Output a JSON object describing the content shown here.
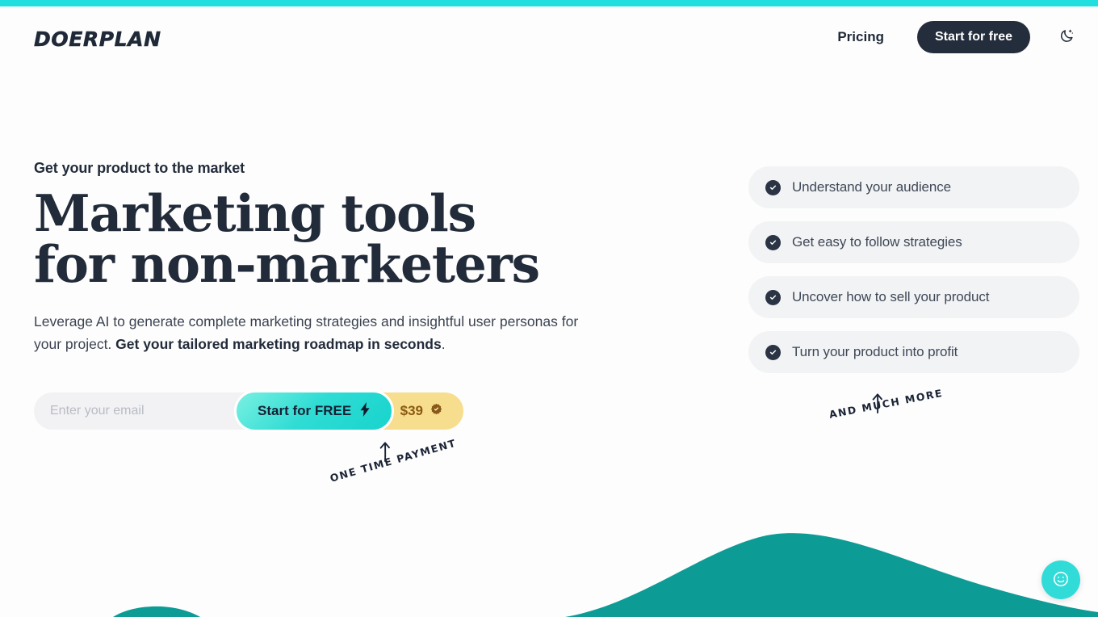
{
  "theme": {
    "accent_cyan": "#22dfdf",
    "dark_navy": "#242d3c",
    "teal_wave": "#0d9b96",
    "badge_yellow": "#f7de8e",
    "badge_text_brown": "#8a5a14",
    "pill_gray": "#f2f3f5",
    "page_background": "#fdfdfd"
  },
  "header": {
    "logo": "DOERPLAN",
    "pricing_label": "Pricing",
    "start_free_label": "Start for free",
    "theme_toggle_icon": "moon-icon"
  },
  "hero": {
    "eyebrow": "Get your product to the market",
    "title": "Marketing tools\nfor non-marketers",
    "subtitle_lead": "Leverage AI to generate complete marketing strategies and insightful user personas for your project. ",
    "subtitle_bold": "Get your tailored marketing roadmap in seconds",
    "subtitle_tail": "."
  },
  "signup": {
    "email_placeholder": "Enter your email",
    "email_value": "",
    "cta_label": "Start for FREE",
    "cta_icon": "lightning-bolt-icon",
    "price_label": "$39",
    "price_icon": "verified-badge-icon"
  },
  "features": {
    "items": [
      {
        "label": "Understand your audience",
        "icon": "check-circle-icon"
      },
      {
        "label": "Get easy to follow strategies",
        "icon": "check-circle-icon"
      },
      {
        "label": "Uncover how to sell your product",
        "icon": "check-circle-icon"
      },
      {
        "label": "Turn your product into profit",
        "icon": "check-circle-icon"
      }
    ]
  },
  "annotations": {
    "and_much_more": "AND MUCH MORE",
    "one_time_payment": "ONE TIME PAYMENT"
  },
  "chat": {
    "icon": "smiley-face-icon"
  }
}
